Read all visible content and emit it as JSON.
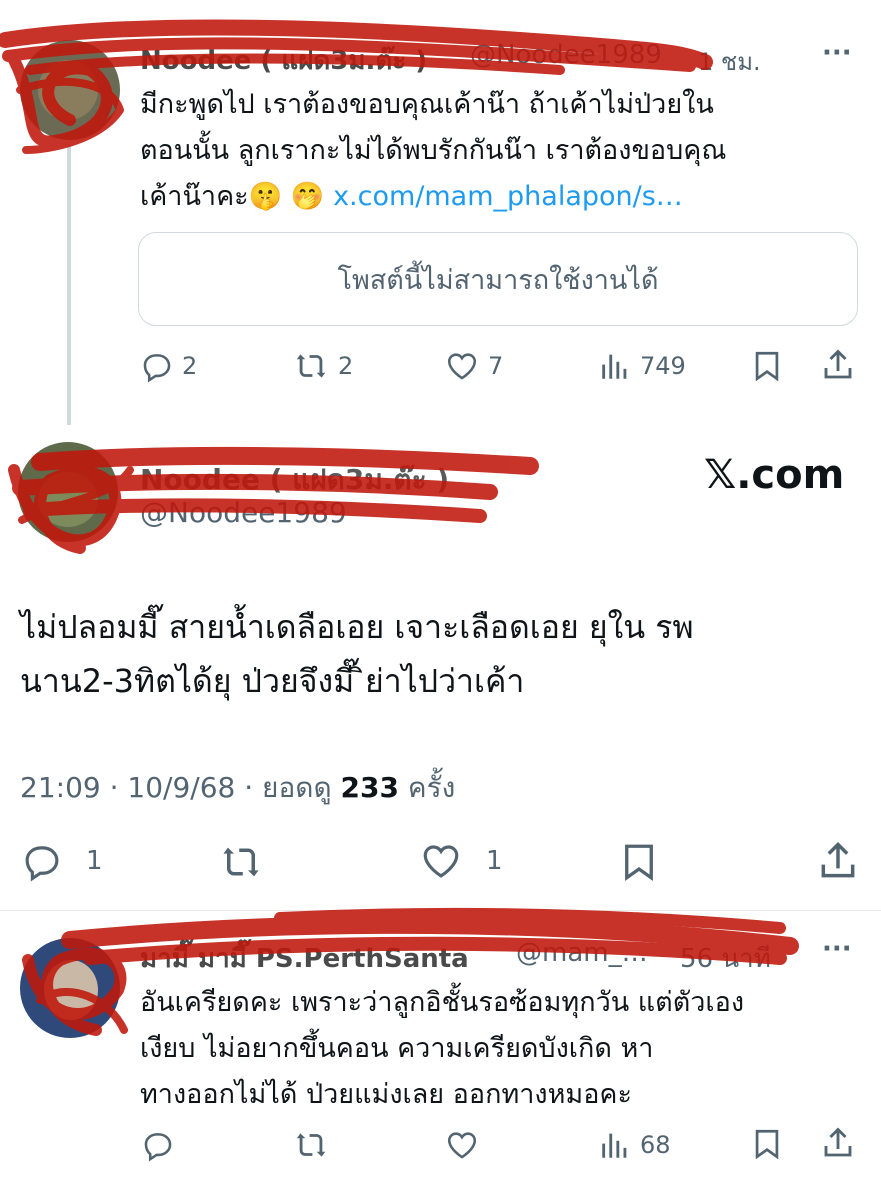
{
  "reply1": {
    "author_name": "Noodee ( แฝด3ม.ต๊ะ )",
    "handle": "@Noodee1989",
    "time": "1 ชม.",
    "more_label": "···",
    "text_lines": [
      "มีกะพูดไป เราต้องขอบคุณเค้าน๊า ถ้าเค้าไม่ป่วยใน",
      "ตอนนั้น ลูกเรากะไม่ได้พบรักกันน๊า เราต้องขอบคุณ"
    ],
    "text_line3_prefix": "เค้าน๊าคะ",
    "emoji": "🤫 🤭",
    "link": "x.com/mam_phalapon/s…",
    "unavailable_card": "โพสต์นี้ไม่สามารถใช้งานได้",
    "stats": {
      "replies": "2",
      "reposts": "2",
      "likes": "7",
      "views": "749"
    }
  },
  "main_post": {
    "author_name": "Noodee ( แฝด3ม.ต๊ะ )",
    "handle": "@Noodee1989",
    "site_logo": "𝕏.com",
    "text_lines": [
      "ไม่ปลอมมี๊ สายน้ำเดลือเอย เจาะเลือดเอย ยุใน รพ",
      "นาน2-3ทิตได้ยุ ป่วยจึงมี๊ ิย่าไปว่าเค้า"
    ],
    "timestamp": "21:09 · 10/9/68 · ยอดดู",
    "views": "233",
    "views_suffix": "ครั้ง",
    "stats": {
      "replies": "1",
      "likes": "1"
    }
  },
  "reply2": {
    "author_name": "มามี๊ มามี๊ PS.PerthSanta",
    "handle": "@mam_…",
    "time": "56 นาที",
    "more_label": "···",
    "text_lines": [
      "อันเครียดคะ เพราะว่าลูกอิชั้นรอซ้อมทุกวัน แต่ตัวเอง",
      "เงียบ ไม่อยากขึ้นคอน ความเครียดบังเกิด  หา",
      "ทางออกไม่ได้ ป่วยแม่งเลย ออกทางหมอคะ"
    ],
    "stats": {
      "views": "68"
    }
  },
  "icons": [
    "reply-icon",
    "repost-icon",
    "like-icon",
    "views-icon",
    "bookmark-icon",
    "share-icon",
    "more-icon",
    "x-logo-icon"
  ],
  "colors": {
    "text": "#0f1419",
    "muted": "#536471",
    "link": "#1d9bf0",
    "redaction": "#c0180c",
    "border": "#cfd9de"
  }
}
